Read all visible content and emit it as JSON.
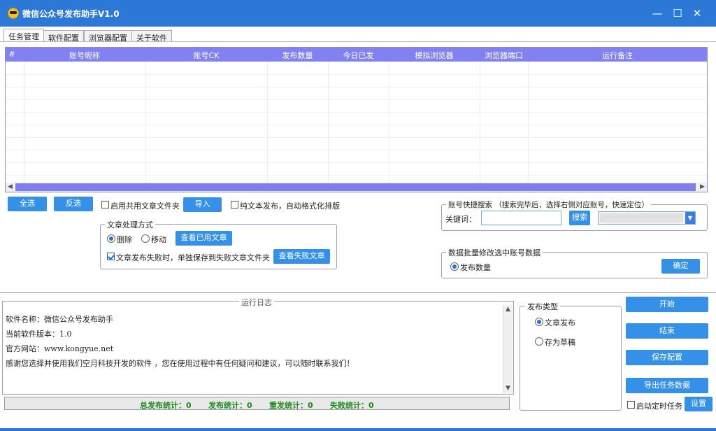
{
  "window": {
    "title": "微信公众号发布助手V1.0",
    "controls": [
      "—",
      "☐",
      "✕"
    ]
  },
  "tabs": [
    "任务管理",
    "软件配置",
    "浏览器配置",
    "关于软件"
  ],
  "grid": {
    "columns": [
      "#",
      "账号昵称",
      "账号CK",
      "发布数量",
      "今日已发",
      "模拟浏览器",
      "浏览器端口",
      "运行备注"
    ]
  },
  "actions": {
    "select_all": "全选",
    "invert": "反选",
    "shared_folder": "启用共用文章文件夹",
    "import": "导入",
    "plain_text": "纯文本发布，自动格式化排版"
  },
  "article_processing": {
    "title": "文章处理方式",
    "delete": "删除",
    "move": "移动",
    "view_used": "查看已用文章",
    "fail_save": "文章发布失败时，单独保存到失败文章文件夹",
    "view_failed": "查看失败文章"
  },
  "search": {
    "title": "账号快捷搜索   （搜索完毕后，选择右侧对应账号，快速定位）",
    "keyword_label": "关键词：",
    "keyword_value": "",
    "button": "搜索"
  },
  "batch": {
    "title": "数据批量修改选中账号数据",
    "option": "发布数量",
    "confirm": "确定"
  },
  "log": {
    "title": "运行日志",
    "lines": [
      "软件名称：微信公众号发布助手",
      "当前软件版本：1.0",
      "官方网站：www.kongyue.net",
      "感谢您选择并使用我们空月科技开发的软件 ，您在使用过程中有任何疑问和建议，可以随时联系我们！"
    ]
  },
  "publish_type": {
    "title": "发布类型",
    "article": "文章发布",
    "draft": "存为草稿"
  },
  "right_buttons": {
    "start": "开始",
    "end": "结束",
    "save": "保存配置",
    "export": "导出任务数据",
    "timer": "启动定时任务",
    "settings": "设置"
  },
  "stats": {
    "total": "总发布统计：0",
    "publish": "发布统计：0",
    "repeat": "重发统计：0",
    "fail": "失败统计：0"
  }
}
